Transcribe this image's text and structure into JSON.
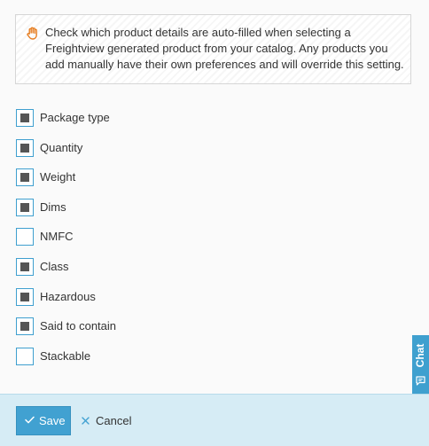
{
  "notice": {
    "icon": "hand-stop-icon",
    "text": "Check which product details are auto-filled when selecting a Freightview generated product from your catalog. Any products you add manually have their own preferences and will override this setting."
  },
  "options": [
    {
      "label": "Package type",
      "checked": true
    },
    {
      "label": "Quantity",
      "checked": true
    },
    {
      "label": "Weight",
      "checked": true
    },
    {
      "label": "Dims",
      "checked": true
    },
    {
      "label": "NMFC",
      "checked": false
    },
    {
      "label": "Class",
      "checked": true
    },
    {
      "label": "Hazardous",
      "checked": true
    },
    {
      "label": "Said to contain",
      "checked": true
    },
    {
      "label": "Stackable",
      "checked": false
    }
  ],
  "chat": {
    "label": "Chat",
    "icon": "chat-bubble-icon"
  },
  "footer": {
    "save_label": "Save",
    "save_icon": "checkmark-icon",
    "cancel_label": "Cancel",
    "cancel_icon": "close-icon"
  },
  "colors": {
    "accent": "#41a1d1",
    "footer_background": "#d6ecf5",
    "checkbox_fill": "#555555",
    "notice_icon": "#e67e22"
  }
}
